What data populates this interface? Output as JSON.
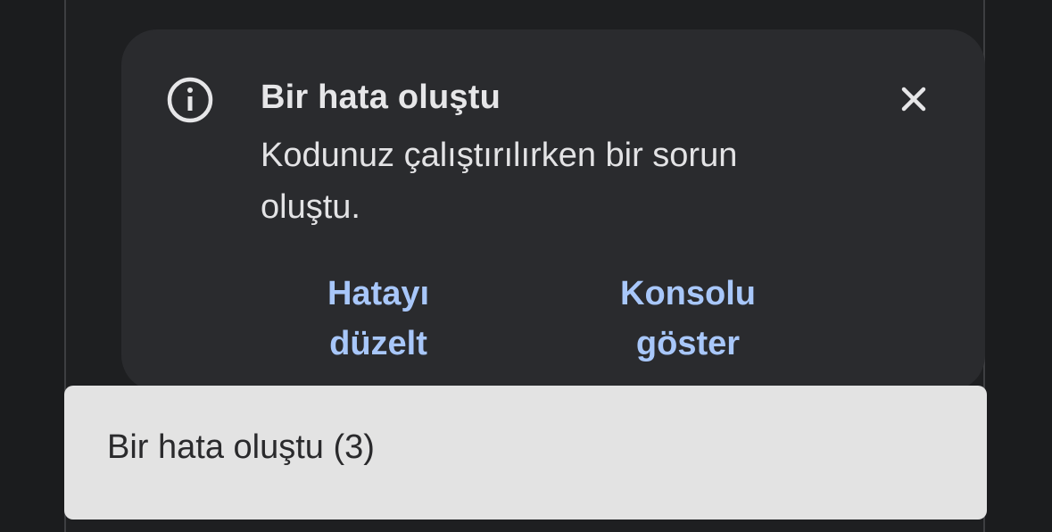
{
  "dialog": {
    "icon": "info-icon",
    "title": "Bir hata oluştu",
    "message": "Kodunuz çalıştırılırken bir sorun oluştu.",
    "close_icon": "close-icon",
    "actions": {
      "fix_line1": "Hatayı",
      "fix_line2": "düzelt",
      "console_line1": "Konsolu",
      "console_line2": "göster"
    },
    "accent_color": "#a8c7fa",
    "background_color": "#2a2b2e"
  },
  "snackbar": {
    "text": "Bir hata oluştu (3)",
    "background_color": "#e3e3e3"
  }
}
